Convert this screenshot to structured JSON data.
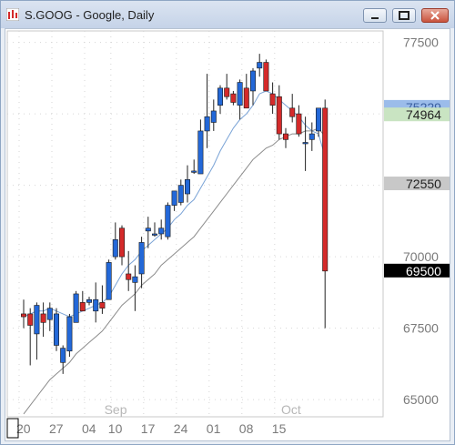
{
  "window": {
    "title": "S.GOOG - Google, Daily"
  },
  "colors": {
    "up": "#2368d8",
    "down": "#d42a2a",
    "ma_fast": "#7aa3d6",
    "ma_slow": "#8b8b8b",
    "last_price_bg": "#000000",
    "level_green": "#c9e4c2",
    "level_gray": "#c8c8c8",
    "level_blue": "#9bbcea"
  },
  "chart_data": {
    "type": "candlestick",
    "title": "S.GOOG - Google, Daily",
    "y_ticks": [
      "77500",
      "75000",
      "72500",
      "70000",
      "67500",
      "65000"
    ],
    "ylim": [
      644.0,
      779.0
    ],
    "x_tick_labels": [
      "20",
      "27",
      "04",
      "10",
      "17",
      "24",
      "01",
      "08",
      "15"
    ],
    "month_labels": [
      "Sep",
      "Oct"
    ],
    "price_labels": [
      {
        "text": "75229",
        "value": 752.29,
        "style": "blue"
      },
      {
        "text": "74964",
        "value": 749.64,
        "style": "green"
      },
      {
        "text": "72550",
        "value": 725.5,
        "style": "gray"
      },
      {
        "text": "69500",
        "value": 695.0,
        "style": "last"
      }
    ],
    "candles": [
      {
        "date": "Aug 19",
        "open": 680,
        "high": 685,
        "low": 675,
        "close": 679
      },
      {
        "date": "Aug 22",
        "open": 680,
        "high": 682,
        "low": 662,
        "close": 676
      },
      {
        "date": "Aug 23",
        "open": 673,
        "high": 684,
        "low": 664,
        "close": 683
      },
      {
        "date": "Aug 24",
        "open": 680,
        "high": 684,
        "low": 672,
        "close": 677
      },
      {
        "date": "Aug 25",
        "open": 678,
        "high": 684,
        "low": 674,
        "close": 682
      },
      {
        "date": "Aug 26",
        "open": 669,
        "high": 682,
        "low": 667,
        "close": 680
      },
      {
        "date": "Aug 29",
        "open": 663,
        "high": 669,
        "low": 659,
        "close": 668
      },
      {
        "date": "Aug 30",
        "open": 667,
        "high": 680,
        "low": 665,
        "close": 679
      },
      {
        "date": "Aug 31",
        "open": 677,
        "high": 688,
        "low": 677,
        "close": 687
      },
      {
        "date": "Sep 01",
        "open": 684,
        "high": 688,
        "low": 681,
        "close": 681
      },
      {
        "date": "Sep 02",
        "open": 684,
        "high": 686,
        "low": 683,
        "close": 685
      },
      {
        "date": "Sep 06",
        "open": 681,
        "high": 691,
        "low": 677,
        "close": 685
      },
      {
        "date": "Sep 07",
        "open": 684,
        "high": 690,
        "low": 680,
        "close": 682
      },
      {
        "date": "Sep 08",
        "open": 685,
        "high": 699,
        "low": 685,
        "close": 698
      },
      {
        "date": "Sep 09",
        "open": 700,
        "high": 712,
        "low": 699,
        "close": 706
      },
      {
        "date": "Sep 12",
        "open": 710,
        "high": 711,
        "low": 697,
        "close": 700
      },
      {
        "date": "Sep 13",
        "open": 694,
        "high": 702,
        "low": 688,
        "close": 692
      },
      {
        "date": "Sep 14",
        "open": 691,
        "high": 697,
        "low": 681,
        "close": 693
      },
      {
        "date": "Sep 15",
        "open": 694,
        "high": 707,
        "low": 689,
        "close": 705
      },
      {
        "date": "Sep 16",
        "open": 709,
        "high": 714,
        "low": 703,
        "close": 710
      },
      {
        "date": "Sep 19",
        "open": 708,
        "high": 712,
        "low": 707,
        "close": 708
      },
      {
        "date": "Sep 20",
        "open": 708,
        "high": 713,
        "low": 706,
        "close": 710
      },
      {
        "date": "Sep 21",
        "open": 707,
        "high": 719,
        "low": 706,
        "close": 718
      },
      {
        "date": "Sep 22",
        "open": 718,
        "high": 723,
        "low": 716,
        "close": 723
      },
      {
        "date": "Sep 23",
        "open": 719,
        "high": 727,
        "low": 718,
        "close": 725
      },
      {
        "date": "Sep 26",
        "open": 722,
        "high": 732,
        "low": 719,
        "close": 727
      },
      {
        "date": "Sep 27",
        "open": 730,
        "high": 734,
        "low": 729,
        "close": 730
      },
      {
        "date": "Sep 28",
        "open": 729,
        "high": 748,
        "low": 729,
        "close": 744
      },
      {
        "date": "Sep 29",
        "open": 744,
        "high": 764,
        "low": 738,
        "close": 749
      },
      {
        "date": "Sep 30",
        "open": 747,
        "high": 755,
        "low": 744,
        "close": 751
      },
      {
        "date": "Oct 03",
        "open": 753,
        "high": 760,
        "low": 750,
        "close": 759
      },
      {
        "date": "Oct 04",
        "open": 759,
        "high": 764,
        "low": 755,
        "close": 756
      },
      {
        "date": "Oct 05",
        "open": 757,
        "high": 758,
        "low": 753,
        "close": 754
      },
      {
        "date": "Oct 06",
        "open": 753,
        "high": 762,
        "low": 748,
        "close": 761
      },
      {
        "date": "Oct 07",
        "open": 759,
        "high": 764,
        "low": 752,
        "close": 752
      },
      {
        "date": "Oct 10",
        "open": 758,
        "high": 766,
        "low": 753,
        "close": 765
      },
      {
        "date": "Oct 11",
        "open": 766,
        "high": 771,
        "low": 763,
        "close": 768
      },
      {
        "date": "Oct 12",
        "open": 768,
        "high": 769,
        "low": 758,
        "close": 758
      },
      {
        "date": "Oct 13",
        "open": 757,
        "high": 761,
        "low": 750,
        "close": 753
      },
      {
        "date": "Oct 14",
        "open": 756,
        "high": 760,
        "low": 741,
        "close": 743
      },
      {
        "date": "Oct 17",
        "open": 743,
        "high": 745,
        "low": 738,
        "close": 741
      },
      {
        "date": "Oct 18",
        "open": 752,
        "high": 757,
        "low": 747,
        "close": 749
      },
      {
        "date": "Oct 19",
        "open": 750,
        "high": 753,
        "low": 742,
        "close": 743
      },
      {
        "date": "Oct 20",
        "open": 740,
        "high": 749,
        "low": 730,
        "close": 740
      },
      {
        "date": "Oct 21",
        "open": 741,
        "high": 747,
        "low": 737,
        "close": 743
      },
      {
        "date": "Oct 24",
        "open": 744,
        "high": 752,
        "low": 742,
        "close": 752
      },
      {
        "date": "Oct 25",
        "open": 752,
        "high": 755,
        "low": 675,
        "close": 695
      }
    ],
    "ma_fast": [
      679,
      680,
      681,
      681,
      682,
      681,
      680,
      679,
      680,
      681,
      682,
      683,
      684,
      686,
      690,
      694,
      697,
      699,
      702,
      704,
      706,
      708,
      710,
      713,
      715,
      718,
      720,
      724,
      728,
      732,
      737,
      741,
      745,
      748,
      750,
      753,
      757,
      758,
      757,
      755,
      753,
      751,
      749,
      746,
      744,
      743,
      735
    ],
    "ma_slow": [
      645,
      648,
      651,
      654,
      657,
      659,
      661,
      663,
      666,
      668,
      670,
      672,
      674,
      677,
      680,
      683,
      685,
      687,
      690,
      692,
      694,
      697,
      699,
      701,
      703,
      705,
      707,
      710,
      713,
      716,
      719,
      722,
      725,
      728,
      731,
      734,
      736,
      738,
      739,
      741,
      742,
      743,
      743,
      744,
      744,
      745,
      742
    ]
  }
}
